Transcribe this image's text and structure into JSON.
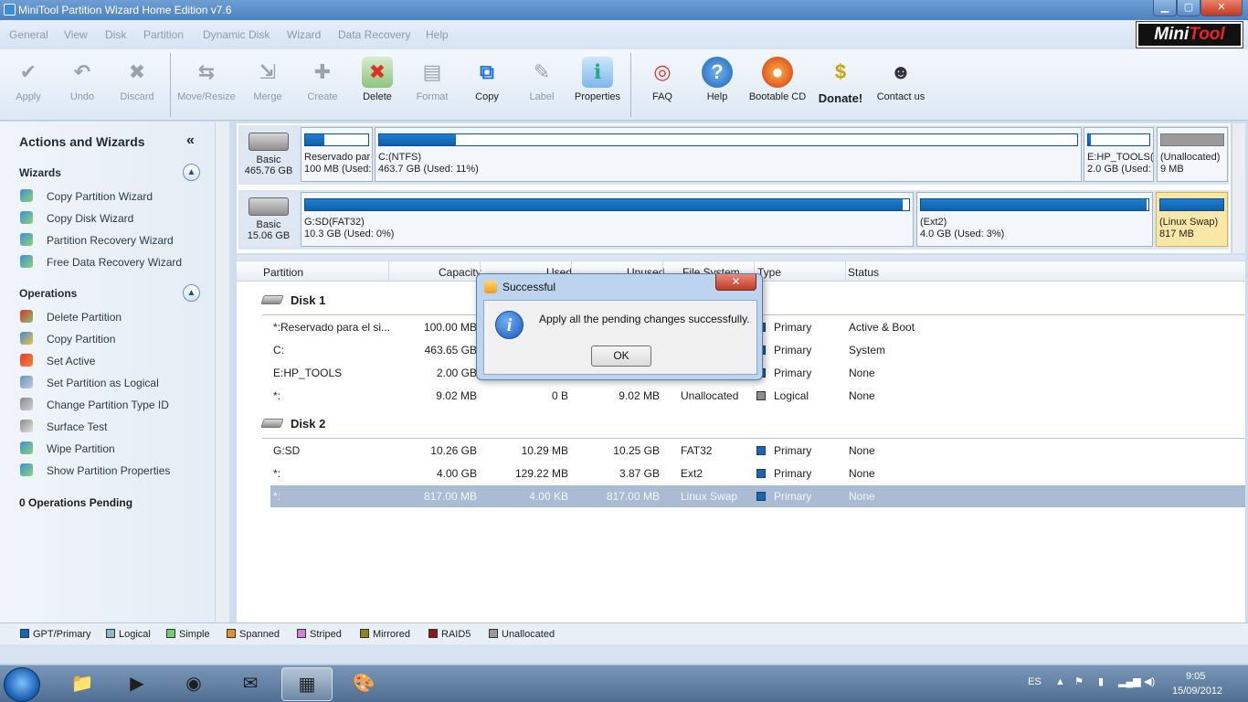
{
  "window": {
    "title": "MiniTool Partition Wizard Home Edition v7.6",
    "min": "▁",
    "max": "▢",
    "close": "✕"
  },
  "logo": {
    "part1": "Mini",
    "part2": "Tool"
  },
  "menu": [
    "General",
    "View",
    "Disk",
    "Partition",
    "Dynamic Disk",
    "Wizard",
    "Data Recovery",
    "Help"
  ],
  "toolbar": {
    "apply": "Apply",
    "undo": "Undo",
    "discard": "Discard",
    "move_resize": "Move/Resize",
    "merge": "Merge",
    "create": "Create",
    "delete": "Delete",
    "format": "Format",
    "copy": "Copy",
    "label": "Label",
    "properties": "Properties",
    "faq": "FAQ",
    "help": "Help",
    "bootable_cd": "Bootable CD",
    "donate": "Donate!",
    "contact": "Contact us"
  },
  "sidebar": {
    "title": "Actions and Wizards",
    "collapse_glyph": "«",
    "wizards_header": "Wizards",
    "wizards": [
      "Copy Partition Wizard",
      "Copy Disk Wizard",
      "Partition Recovery Wizard",
      "Free Data Recovery Wizard"
    ],
    "operations_header": "Operations",
    "operations": [
      "Delete Partition",
      "Copy Partition",
      "Set Active",
      "Set Partition as Logical",
      "Change Partition Type ID",
      "Surface Test",
      "Wipe Partition",
      "Show Partition Properties"
    ],
    "pending": "0 Operations Pending"
  },
  "diskmap": {
    "disk1": {
      "type": "Basic",
      "size": "465.76 GB",
      "partitions": [
        {
          "name": "Reservado par",
          "detail": "100 MB (Used:",
          "used": 0.3
        },
        {
          "name": "C:(NTFS)",
          "detail": "463.7 GB (Used: 11%)",
          "used": 0.11
        },
        {
          "name": "E:HP_TOOLS(F",
          "detail": "2.0 GB (Used:",
          "used": 0.05
        },
        {
          "name": "(Unallocated)",
          "detail": "9 MB",
          "used": 1.0
        }
      ]
    },
    "disk2": {
      "type": "Basic",
      "size": "15.06 GB",
      "partitions": [
        {
          "name": "G:SD(FAT32)",
          "detail": "10.3 GB (Used: 0%)",
          "used": 0.0
        },
        {
          "name": "(Ext2)",
          "detail": "4.0 GB (Used: 3%)",
          "used": 0.03
        },
        {
          "name": "(Linux Swap)",
          "detail": "817 MB",
          "used": 0.0
        }
      ]
    }
  },
  "table": {
    "headers": [
      "Partition",
      "Capacity",
      "Used",
      "Unused",
      "File System",
      "Type",
      "Status"
    ],
    "disk1_label": "Disk 1",
    "disk2_label": "Disk 2",
    "disk1_rows": [
      {
        "partition": "*:Reservado para el si...",
        "capacity": "100.00 MB",
        "used": "",
        "unused": "",
        "fs": "",
        "type": "Primary",
        "status": "Active & Boot",
        "color": "#1565b8"
      },
      {
        "partition": "C:",
        "capacity": "463.65 GB",
        "used": "",
        "unused": "",
        "fs": "",
        "type": "Primary",
        "status": "System",
        "color": "#1565b8"
      },
      {
        "partition": "E:HP_TOOLS",
        "capacity": "2.00 GB",
        "used": "",
        "unused": "",
        "fs": "",
        "type": "Primary",
        "status": "None",
        "color": "#1565b8"
      },
      {
        "partition": "*:",
        "capacity": "9.02 MB",
        "used": "0 B",
        "unused": "9.02 MB",
        "fs": "Unallocated",
        "type": "Logical",
        "status": "None",
        "color": "#8c8c8c"
      }
    ],
    "disk2_rows": [
      {
        "partition": "G:SD",
        "capacity": "10.26 GB",
        "used": "10.29 MB",
        "unused": "10.25 GB",
        "fs": "FAT32",
        "type": "Primary",
        "status": "None",
        "color": "#1565b8"
      },
      {
        "partition": "*:",
        "capacity": "4.00 GB",
        "used": "129.22 MB",
        "unused": "3.87 GB",
        "fs": "Ext2",
        "type": "Primary",
        "status": "None",
        "color": "#1565b8"
      },
      {
        "partition": "*:",
        "capacity": "817.00 MB",
        "used": "4.00 KB",
        "unused": "817.00 MB",
        "fs": "Linux Swap",
        "type": "Primary",
        "status": "None",
        "color": "#1565b8"
      }
    ]
  },
  "legend": [
    {
      "label": "GPT/Primary",
      "color": "#1565b8"
    },
    {
      "label": "Logical",
      "color": "#8fb9c9"
    },
    {
      "label": "Simple",
      "color": "#6cd06c"
    },
    {
      "label": "Spanned",
      "color": "#e3912b"
    },
    {
      "label": "Striped",
      "color": "#d27fd6"
    },
    {
      "label": "Mirrored",
      "color": "#8c8420"
    },
    {
      "label": "RAID5",
      "color": "#8c1a1a"
    },
    {
      "label": "Unallocated",
      "color": "#9a9a9a"
    }
  ],
  "dialog": {
    "title": "Successful",
    "message": "Apply all the pending changes successfully.",
    "ok": "OK",
    "close": "✕",
    "info_glyph": "i"
  },
  "taskbar": {
    "lang": "ES",
    "time": "9:05",
    "date": "15/09/2012"
  }
}
